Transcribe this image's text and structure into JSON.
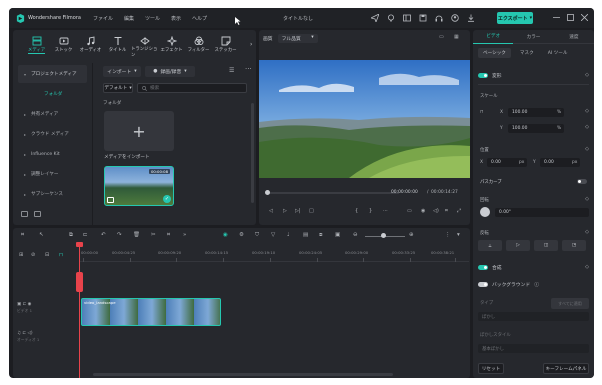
{
  "title_bar": {
    "app_name": "Wondershare Filmora",
    "menus": [
      "ファイル",
      "編集",
      "ツール",
      "表示",
      "ヘルプ"
    ],
    "project_title": "タイトルなし",
    "export_label": "エクスポート"
  },
  "toolbar": {
    "tools": [
      {
        "label": "メディア",
        "icon": "media-icon",
        "active": true
      },
      {
        "label": "ストック",
        "icon": "stock-icon",
        "active": false
      },
      {
        "label": "オーディオ",
        "icon": "music-note-icon",
        "active": false
      },
      {
        "label": "タイトル",
        "icon": "title-t-icon",
        "active": false
      },
      {
        "label": "トランジション",
        "icon": "transition-icon",
        "active": false
      },
      {
        "label": "エフェクト",
        "icon": "effects-icon",
        "active": false
      },
      {
        "label": "フィルター",
        "icon": "filter-icon",
        "active": false
      },
      {
        "label": "ステッカー",
        "icon": "sticker-icon",
        "active": false
      }
    ]
  },
  "sidebar": {
    "header": "プロジェクトメディア",
    "selected": "フォルダ",
    "items": [
      "共有メディア",
      "クラウド メディア",
      "Influence Kit",
      "調整レイヤー",
      "サブシーケンス"
    ]
  },
  "media": {
    "import_label": "インポート",
    "record_label": "録画/録音",
    "sort_label": "デフォルト",
    "search_placeholder": "検索",
    "folder_label": "フォルダ",
    "import_card_label": "メディアをインポート",
    "clip_duration": "00:00:08"
  },
  "preview": {
    "quality_label": "画質",
    "quality_value": "フル品質",
    "current_time": "00:00:00:00",
    "total_time": "00:00:14:27"
  },
  "inspector": {
    "tabs": [
      "ビデオ",
      "カラー",
      "速度"
    ],
    "subtabs": [
      "ベーシック",
      "マスク",
      "AI ツール"
    ],
    "transform_label": "変形",
    "scale_label": "スケール",
    "scale_x_label": "X",
    "scale_x": "100.00",
    "scale_y_label": "Y",
    "scale_y": "100.00",
    "unit_percent": "%",
    "position_label": "位置",
    "pos_x_label": "X",
    "pos_x": "0.00",
    "pos_y_label": "Y",
    "pos_y": "0.00",
    "unit_px": "px",
    "path_curve_label": "パスカーブ",
    "rotate_label": "回転",
    "rotate_value": "0.00°",
    "flip_label": "反転",
    "composite_label": "合成",
    "background_label": "バックグラウンド",
    "type_label": "タイプ",
    "type_apply_label": "すべてに適用",
    "type_value": "ぼかし",
    "blur_style_label": "ぼかしスタイル",
    "blur_style_value": "基本ぼかし",
    "reset_label": "リセット",
    "keyframe_label": "キーフレームパネル"
  },
  "timeline": {
    "ruler": [
      "00:00:00",
      "00:00:04:25",
      "00:00:09:20",
      "00:00:14:15",
      "00:00:19:10",
      "00:00:24:05",
      "00:00:29:00",
      "00:00:33:25",
      "00:00:38:21"
    ],
    "video_track": "ビデオ 1",
    "audio_track": "オーディオ 1",
    "clip_name": "video_landscape"
  },
  "colors": {
    "accent": "#25c7b0",
    "playhead": "#e8434b"
  }
}
